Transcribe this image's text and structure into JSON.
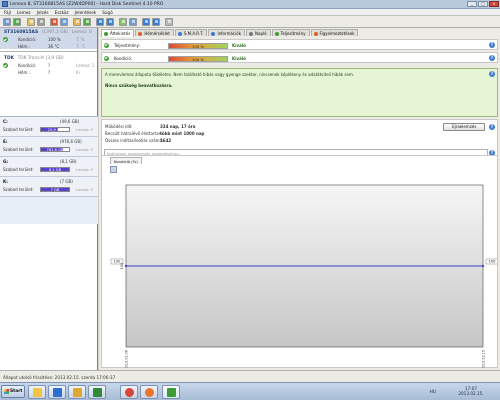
{
  "window": {
    "title": "Lenovo 8, ST3160815AS [Z2W4DP00] - Hard Disk Sentinel 4.10 PRO",
    "minimize": "_",
    "maximize": "□",
    "close": "×"
  },
  "menu": [
    "Fájl",
    "Lemez",
    "Jelzés",
    "Eszköz",
    "Jelentések",
    "Súgó"
  ],
  "toolbar_icons": [
    "disk-icon",
    "refresh-icon",
    "save-icon",
    "report-icon",
    "test-icon",
    "settings-icon",
    "alert-icon",
    "network-icon",
    "clone-icon",
    "backup-icon",
    "schedule-icon",
    "performance-icon",
    "help-icon",
    "info-icon",
    "window-icon"
  ],
  "disks": [
    {
      "name": "ST3160815AS",
      "size": "(1397,3 GB)",
      "target": "Lemez: 0",
      "rows": [
        {
          "label": "Kondíció:",
          "value": "100 %",
          "target": "T: %"
        },
        {
          "label": "Hőm.:",
          "value": "36 °C",
          "target": "T: °C"
        }
      ]
    },
    {
      "name": "TDK",
      "size": "TDK Trans-It (3,9 GB)",
      "rows": [
        {
          "label": "Kondíció:",
          "value": "?",
          "target": "Lemez: 1"
        },
        {
          "label": "Hőm.:",
          "value": "?",
          "target": "Ki"
        }
      ]
    }
  ],
  "partitions": [
    {
      "letter": "C:",
      "size": "(49,6 GB)",
      "free_label": "Szabad terület:",
      "free": "29,9 GB",
      "free_pct": 0.6,
      "color": "#5a3fd1",
      "target": "Lemez: 0"
    },
    {
      "letter": "E:",
      "size": "(976,6 GB)",
      "free_label": "Szabad terület:",
      "free": "762,6 GB",
      "free_pct": 0.78,
      "color": "#5a3fd1",
      "target": "Lemez: 0"
    },
    {
      "letter": "G:",
      "size": "(8,1 GB)",
      "free_label": "Szabad terület:",
      "free": "8,1 GB",
      "free_pct": 1.0,
      "color": "#5a3fd1",
      "target": "Lemez: 0"
    },
    {
      "letter": "K:",
      "size": "(7 GB)",
      "free_label": "Szabad terület:",
      "free": "7 GB",
      "free_pct": 1.0,
      "color": "#5a3fd1",
      "target": "Lemez: 0"
    }
  ],
  "tabs": [
    {
      "label": "Áttekintés",
      "icon_color": "#3f9b34",
      "active": true
    },
    {
      "label": "Hőmérséklet",
      "icon_color": "#d9602a"
    },
    {
      "label": "S.M.A.R.T.",
      "icon_color": "#3b7bd4"
    },
    {
      "label": "Információk",
      "icon_color": "#3b7bd4"
    },
    {
      "label": "Napló",
      "icon_color": "#777777"
    },
    {
      "label": "Teljesítmény",
      "icon_color": "#3f9b34"
    },
    {
      "label": "Figyelmeztetések",
      "icon_color": "#d9602a"
    }
  ],
  "status": {
    "performance_label": "Teljesítmény:",
    "performance_value": "100 %",
    "performance_rating": "Kiváló",
    "health_label": "Kondíció:",
    "health_value": "100 %",
    "health_rating": "Kiváló",
    "help": "?"
  },
  "summary": {
    "text": "A merevlemez állapota tökéletes. Nem található hibás vagy gyenge szektor, nincsenek képlékeny és adatátviteli hibák sem.",
    "action": "Nincs szükség beavatkozásra."
  },
  "info": {
    "uptime_label": "Működési idő:",
    "uptime_value": "334 nap, 17 óra",
    "remaining_label": "Becsült hátralévő élettartam:",
    "remaining_value": "több mint 1000 nap",
    "starts_label": "Összes indítás/leállás száma:",
    "starts_value": "1642",
    "repeat_button": "Újraelemzés",
    "comment_placeholder": "Kattintson megjegyzés megadásához..."
  },
  "chart_tab": "Kondíció (%)",
  "chart_data": {
    "type": "line",
    "x": [
      "2013.02.06",
      "2013.02.15"
    ],
    "series": [
      {
        "values": [
          100,
          100
        ]
      }
    ],
    "ylabel": "",
    "ylim": [
      0,
      200
    ],
    "y_ticks": [
      100
    ],
    "point_labels": [
      "100",
      "100"
    ],
    "grid": false
  },
  "statusbar": "Állapot utolsó frissítése: 2013.02.15. szerda 17:06:37",
  "taskbar": {
    "start": "Start",
    "apps": [
      {
        "name": "taskbar-explorer",
        "color": "#f3c342"
      },
      {
        "name": "taskbar-media",
        "color": "#2c6fd1"
      },
      {
        "name": "taskbar-folder",
        "color": "#e0a830"
      },
      {
        "name": "taskbar-excel",
        "color": "#2f8a3a"
      },
      {
        "name": "taskbar-chrome",
        "color": "#d8453a"
      },
      {
        "name": "taskbar-firefox",
        "color": "#e9742b"
      },
      {
        "name": "taskbar-hdsentinel",
        "color": "#3f9b34"
      }
    ],
    "lang": "HU",
    "time": "17:07",
    "date": "2013.02.15."
  }
}
